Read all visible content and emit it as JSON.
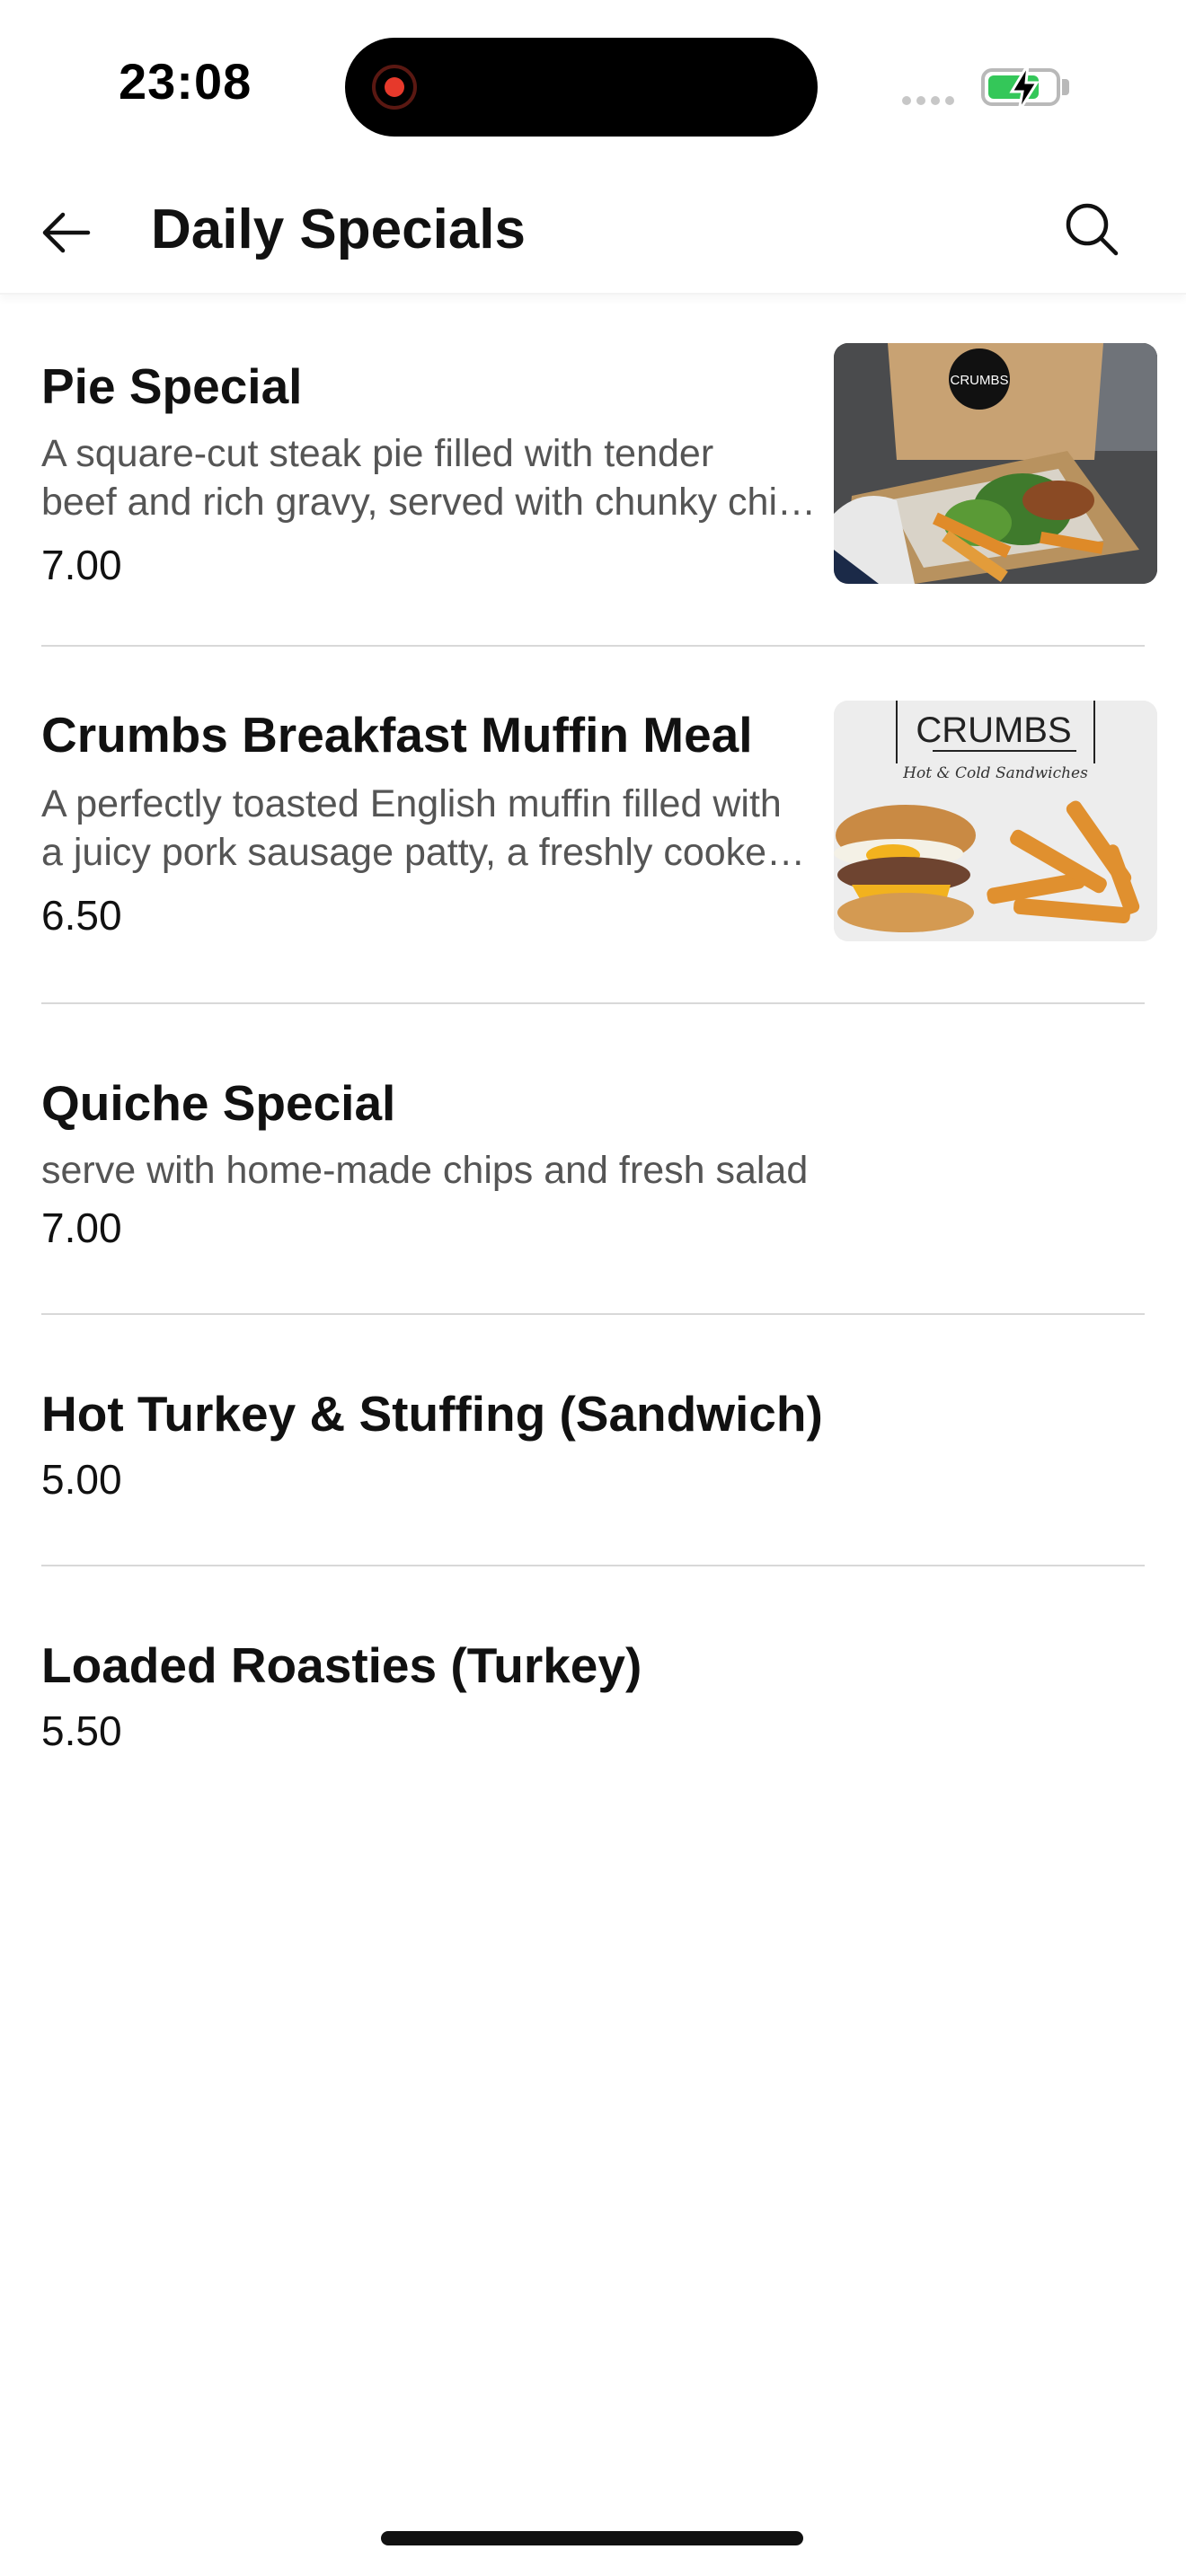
{
  "status_bar": {
    "time": "23:08"
  },
  "header": {
    "title": "Daily Specials"
  },
  "items": [
    {
      "name": "Pie Special",
      "desc_line1": "A square-cut steak pie filled with tender",
      "desc_line2": "beef and rich gravy, served with chunky chi…",
      "price": "7.00",
      "image_text": "CRUMBS"
    },
    {
      "name": "Crumbs Breakfast Muffin Meal",
      "desc_line1": "A perfectly toasted English muffin filled with",
      "desc_line2": "a juicy pork sausage patty, a freshly cooke…",
      "price": "6.50",
      "image_text": "CRUMBS",
      "image_subtext": "Hot & Cold Sandwiches"
    },
    {
      "name": "Quiche Special",
      "desc_line1": "serve with home-made chips and fresh salad",
      "price": "7.00"
    },
    {
      "name": "Hot Turkey & Stuffing  (Sandwich)",
      "price": "5.00"
    },
    {
      "name": "Loaded Roasties (Turkey)",
      "price": "5.50"
    }
  ]
}
